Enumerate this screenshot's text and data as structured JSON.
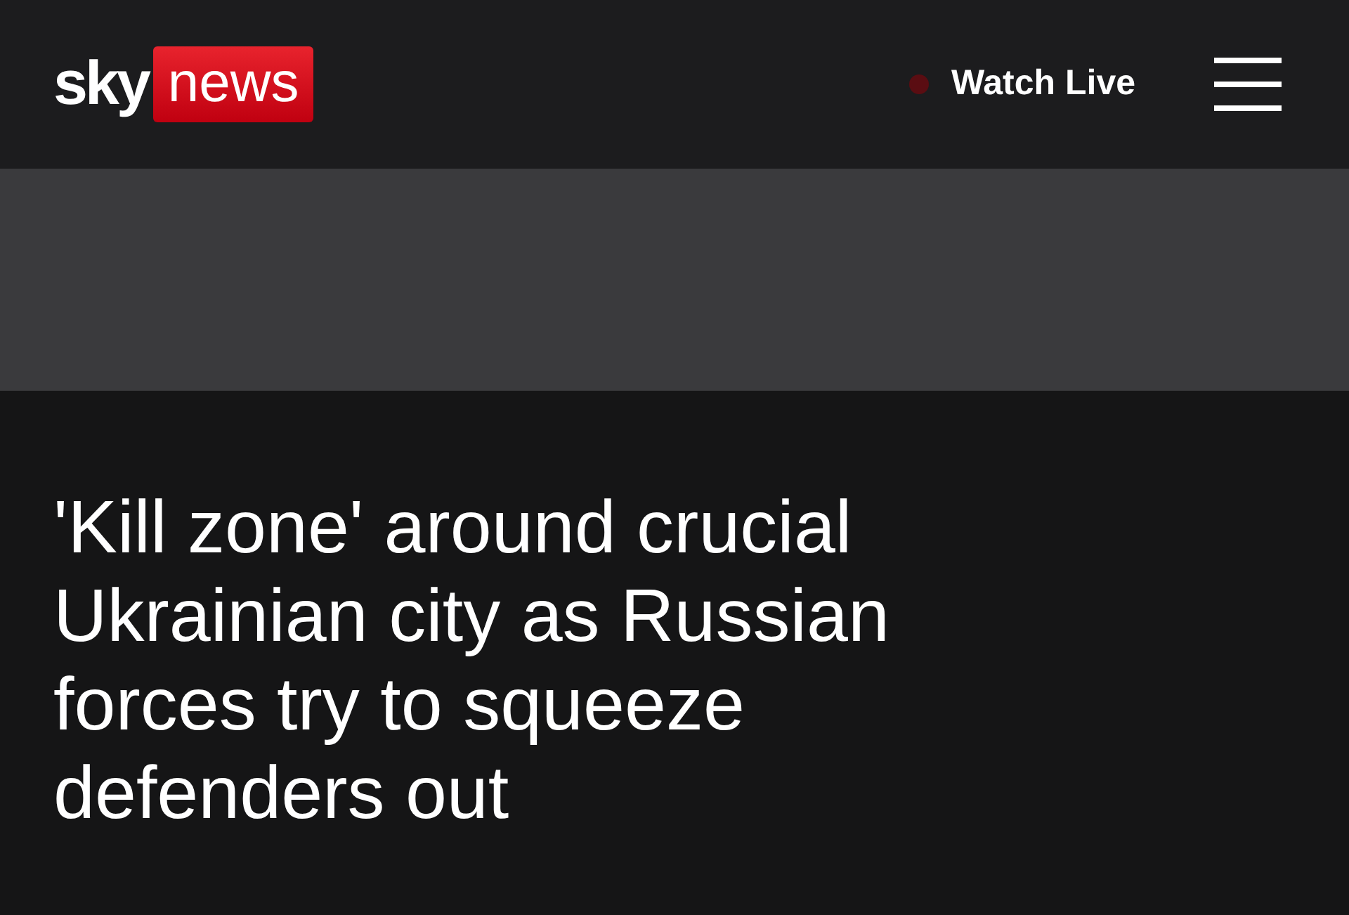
{
  "header": {
    "logo": {
      "part_1": "sky",
      "part_2": "news"
    },
    "watch_live": "Watch Live"
  },
  "headline": "'Kill zone' around crucial Ukrainian city as Russian forces try to squeeze defenders out"
}
